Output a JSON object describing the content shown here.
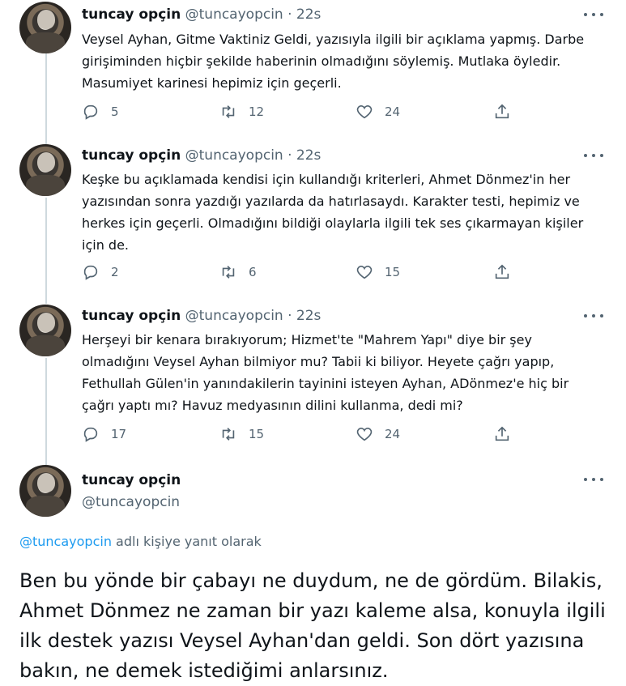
{
  "tweets": [
    {
      "name": "tuncay opçin",
      "handle": "@tuncayopcin",
      "time": "· 22s",
      "text": "Veysel Ayhan, Gitme Vaktiniz Geldi, yazısıyla ilgili bir açıklama yapmış. Darbe girişiminden hiçbir şekilde haberinin olmadığını söylemiş. Mutlaka öyledir. Masumiyet karinesi hepimiz için geçerli.",
      "replies": "5",
      "retweets": "12",
      "likes": "24"
    },
    {
      "name": "tuncay opçin",
      "handle": "@tuncayopcin",
      "time": "· 22s",
      "text": "Keşke bu açıklamada kendisi için kullandığı kriterleri, Ahmet Dönmez'in her yazısından sonra yazdığı yazılarda da hatırlasaydı. Karakter testi, hepimiz ve herkes için geçerli. Olmadığını bildiği olaylarla ilgili tek ses çıkarmayan kişiler için de.",
      "replies": "2",
      "retweets": "6",
      "likes": "15"
    },
    {
      "name": "tuncay opçin",
      "handle": "@tuncayopcin",
      "time": "· 22s",
      "text": "Herşeyi bir kenara bırakıyorum; Hizmet'te \"Mahrem Yapı\" diye bir şey olmadığını Veysel Ayhan bilmiyor mu? Tabii ki biliyor. Heyete çağrı yapıp, Fethullah Gülen'in yanındakilerin tayinini isteyen Ayhan, ADönmez'e hiç bir çağrı yaptı mı? Havuz medyasının dilini kullanma, dedi mi?",
      "replies": "17",
      "retweets": "15",
      "likes": "24"
    }
  ],
  "main_tweet": {
    "name": "tuncay opçin",
    "handle": "@tuncayopcin",
    "reply_mention": "@tuncayopcin",
    "reply_suffix": " adlı kişiye yanıt olarak",
    "text": "Ben bu yönde bir çabayı ne duydum, ne de gördüm. Bilakis, Ahmet Dönmez ne zaman bir yazı kaleme alsa, konuyla ilgili ilk destek yazısı Veysel Ayhan'dan geldi. Son dört yazısına bakın, ne demek istediğimi anlarsınız."
  },
  "icons": {
    "reply": "reply-icon",
    "retweet": "retweet-icon",
    "like": "heart-icon",
    "share": "share-icon",
    "more": "more-dots-icon"
  },
  "colors": {
    "text": "#0f1419",
    "secondary": "#536471",
    "accent": "#1d9bf0",
    "thread_line": "#cfd9de"
  }
}
